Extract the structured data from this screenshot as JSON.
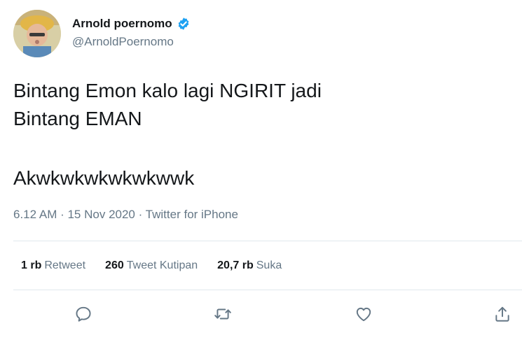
{
  "user": {
    "display_name": "Arnold poernomo",
    "handle": "@ArnoldPoernomo",
    "verified": true
  },
  "tweet": {
    "lines": [
      "Bintang Emon kalo lagi NGIRIT jadi",
      "Bintang EMAN",
      "Akwkwkwkwkwkwwk"
    ],
    "timestamp": "6.12 AM · 15 Nov 2020 · Twitter for iPhone"
  },
  "stats": {
    "retweets": {
      "count": "1 rb",
      "label": "Retweet"
    },
    "quotes": {
      "count": "260",
      "label": "Tweet Kutipan"
    },
    "likes": {
      "count": "20,7 rb",
      "label": "Suka"
    }
  },
  "actions": [
    {
      "icon": "reply-icon"
    },
    {
      "icon": "retweet-icon"
    },
    {
      "icon": "like-icon"
    },
    {
      "icon": "share-icon"
    }
  ],
  "colors": {
    "text_primary": "#14171a",
    "text_secondary": "#657786",
    "verified_blue": "#1da1f2",
    "divider": "#e1e8ed"
  }
}
